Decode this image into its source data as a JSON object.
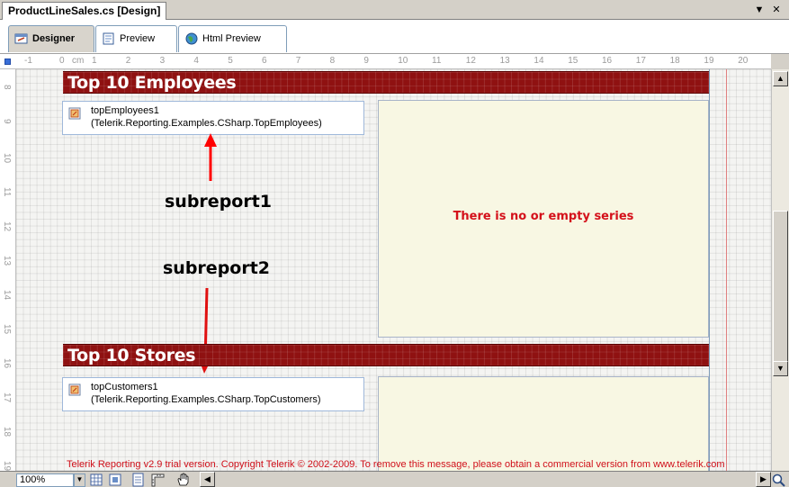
{
  "document_tab": {
    "title": "ProductLineSales.cs [Design]"
  },
  "window_buttons": {
    "dropdown": "▼",
    "close": "✕"
  },
  "view_tabs": [
    {
      "label": "Designer",
      "icon": "designer-icon"
    },
    {
      "label": "Preview",
      "icon": "preview-icon"
    },
    {
      "label": "Html Preview",
      "icon": "globe-icon"
    }
  ],
  "ruler": {
    "horizontal": [
      "-1",
      "0",
      "cm",
      "1",
      "2",
      "3",
      "4",
      "5",
      "6",
      "7",
      "8",
      "9",
      "10",
      "11",
      "12",
      "13",
      "14",
      "15",
      "16",
      "17",
      "18",
      "19",
      "20"
    ],
    "vertical": [
      "8",
      "9",
      "10",
      "11",
      "12",
      "13",
      "14",
      "15",
      "16",
      "17",
      "18",
      "19"
    ]
  },
  "report": {
    "section1": {
      "title": "Top 10 Employees",
      "subreport_name": "topEmployees1",
      "subreport_type": "(Telerik.Reporting.Examples.CSharp.TopEmployees)",
      "chart_message": "There is no or empty series"
    },
    "section2": {
      "title": "Top 10 Stores",
      "subreport_name": "topCustomers1",
      "subreport_type": "(Telerik.Reporting.Examples.CSharp.TopCustomers)"
    },
    "annotations": {
      "first": "subreport1",
      "second": "subreport2"
    },
    "trial_message": "Telerik Reporting v2.9 trial version. Copyright Telerik © 2002-2009. To remove this message, please obtain a commercial version from www.telerik.com"
  },
  "bottom_bar": {
    "zoom": "100%"
  },
  "colors": {
    "band": "#8f1111",
    "chart_bg": "#f8f7e3",
    "message_red": "#d4101a",
    "arrow_red": "#ff0000"
  }
}
